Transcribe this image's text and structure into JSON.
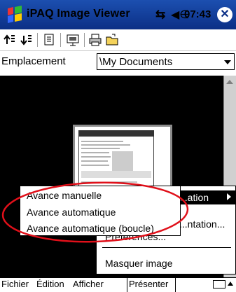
{
  "titlebar": {
    "title": "iPAQ Image Viewer",
    "time": "07:43",
    "icons": [
      "start-flag-icon",
      "connectivity-icon",
      "volume-icon",
      "close-icon"
    ]
  },
  "toolbar": {
    "icons": [
      "sort-ascending-icon",
      "sort-descending-icon",
      "properties-icon",
      "slideshow-icon",
      "print-icon",
      "open-folder-icon"
    ]
  },
  "location": {
    "label": "Emplacement",
    "value": "\\My Documents"
  },
  "present_menu": {
    "items": [
      "...ation",
      "...ntation...",
      "Préférences...",
      "Masquer image"
    ],
    "highlighted_index": 0
  },
  "submenu": {
    "items": [
      "Avance manuelle",
      "Avance automatique",
      "Avance automatique (boucle)"
    ]
  },
  "menubar": {
    "items": [
      "Fichier",
      "Édition",
      "Afficher",
      "Présenter"
    ],
    "active": "Présenter"
  },
  "annotation": {
    "color": "#e0101a"
  }
}
